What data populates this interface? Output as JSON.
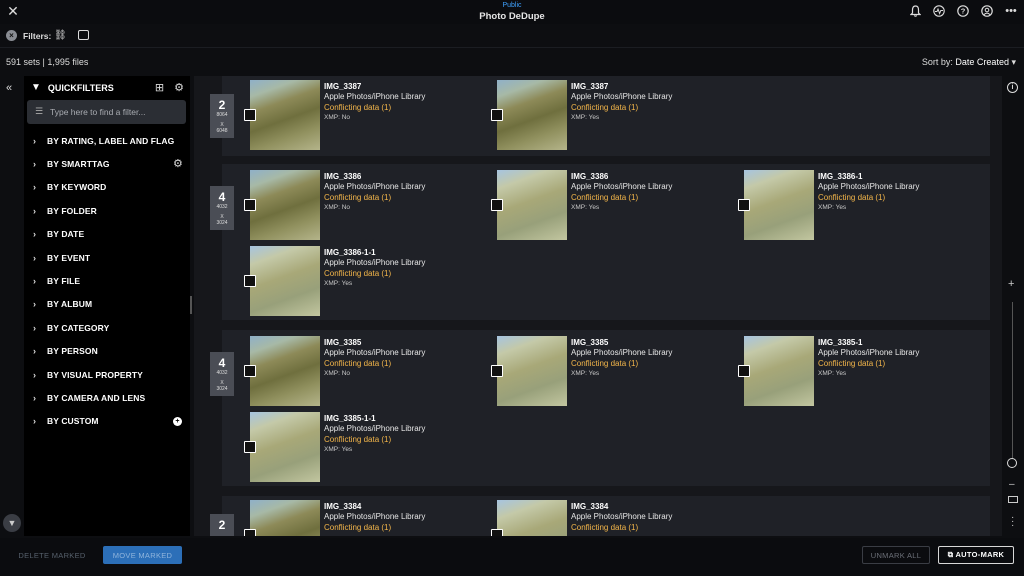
{
  "titlebar": {
    "context": "Public",
    "title": "Photo DeDupe",
    "close_icon": "close-icon",
    "icons": [
      "bell-icon",
      "activity-icon",
      "help-icon",
      "account-icon",
      "more-icon"
    ]
  },
  "filters": {
    "label": "Filters:"
  },
  "stats": {
    "text": "591 sets  |  1,995 files",
    "sort_label": "Sort by:",
    "sort_value": "Date Created"
  },
  "quickfilters": {
    "title": "QUICKFILTERS",
    "search_placeholder": "Type here to find a filter...",
    "items": [
      {
        "label": "BY RATING, LABEL AND FLAG"
      },
      {
        "label": "BY SMARTTAG"
      },
      {
        "label": "BY KEYWORD"
      },
      {
        "label": "BY FOLDER"
      },
      {
        "label": "BY DATE"
      },
      {
        "label": "BY EVENT"
      },
      {
        "label": "BY FILE"
      },
      {
        "label": "BY ALBUM"
      },
      {
        "label": "BY CATEGORY"
      },
      {
        "label": "BY PERSON"
      },
      {
        "label": "BY VISUAL PROPERTY"
      },
      {
        "label": "BY CAMERA AND LENS"
      },
      {
        "label": "BY CUSTOM"
      }
    ]
  },
  "sets": [
    {
      "count": "2",
      "dims": [
        "8064",
        "X",
        "6048"
      ],
      "items": [
        {
          "name": "IMG_3387",
          "source": "Apple Photos/iPhone Library",
          "conflict": "Conflicting data (1)",
          "xmp": "XMP: No"
        },
        {
          "name": "IMG_3387",
          "source": "Apple Photos/iPhone Library",
          "conflict": "Conflicting data (1)",
          "xmp": "XMP: Yes"
        }
      ]
    },
    {
      "count": "4",
      "dims": [
        "4032",
        "X",
        "3024"
      ],
      "items": [
        {
          "name": "IMG_3386",
          "source": "Apple Photos/iPhone Library",
          "conflict": "Conflicting data (1)",
          "xmp": "XMP: No"
        },
        {
          "name": "IMG_3386",
          "source": "Apple Photos/iPhone Library",
          "conflict": "Conflicting data (1)",
          "xmp": "XMP: Yes"
        },
        {
          "name": "IMG_3386-1",
          "source": "Apple Photos/iPhone Library",
          "conflict": "Conflicting data (1)",
          "xmp": "XMP: Yes"
        },
        {
          "name": "IMG_3386-1-1",
          "source": "Apple Photos/iPhone Library",
          "conflict": "Conflicting data (1)",
          "xmp": "XMP: Yes"
        }
      ]
    },
    {
      "count": "4",
      "dims": [
        "4032",
        "X",
        "3024"
      ],
      "items": [
        {
          "name": "IMG_3385",
          "source": "Apple Photos/iPhone Library",
          "conflict": "Conflicting data (1)",
          "xmp": "XMP: No"
        },
        {
          "name": "IMG_3385",
          "source": "Apple Photos/iPhone Library",
          "conflict": "Conflicting data (1)",
          "xmp": "XMP: Yes"
        },
        {
          "name": "IMG_3385-1",
          "source": "Apple Photos/iPhone Library",
          "conflict": "Conflicting data (1)",
          "xmp": "XMP: Yes"
        },
        {
          "name": "IMG_3385-1-1",
          "source": "Apple Photos/iPhone Library",
          "conflict": "Conflicting data (1)",
          "xmp": "XMP: Yes"
        }
      ]
    },
    {
      "count": "2",
      "dims": [],
      "items": [
        {
          "name": "IMG_3384",
          "source": "Apple Photos/iPhone Library",
          "conflict": "Conflicting data (1)",
          "xmp": ""
        },
        {
          "name": "IMG_3384",
          "source": "Apple Photos/iPhone Library",
          "conflict": "Conflicting data (1)",
          "xmp": ""
        }
      ]
    }
  ],
  "footer": {
    "delete": "DELETE MARKED",
    "move": "MOVE MARKED",
    "unmark": "UNMARK ALL",
    "auto": "AUTO-MARK"
  },
  "colors": {
    "accent": "#3fa2ff",
    "conflict": "#f3b64a",
    "move_button": "#2c6fb8"
  }
}
